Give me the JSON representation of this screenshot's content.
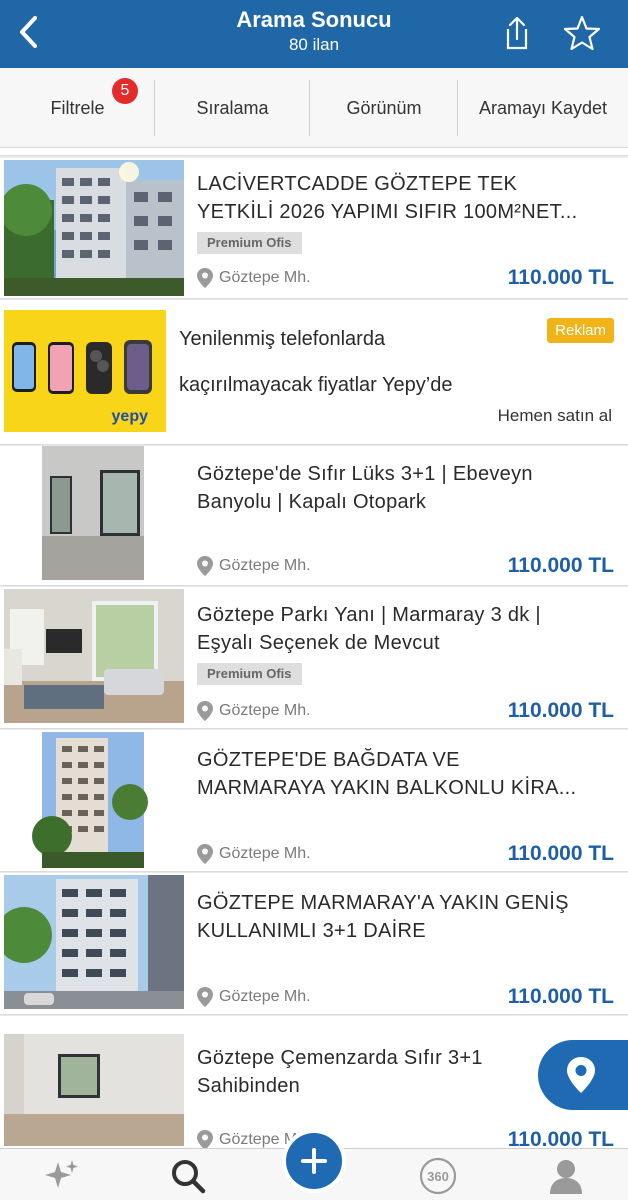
{
  "header": {
    "title": "Arama Sonucu",
    "count": "80 ilan"
  },
  "toolbar": {
    "filter_label": "Filtrele",
    "filter_count": "5",
    "sort_label": "Sıralama",
    "view_label": "Görünüm",
    "save_label": "Aramayı Kaydet"
  },
  "listings": [
    {
      "title1": "LACİVERTCADDE GÖZTEPE TEK",
      "title2": "YETKİLİ 2026 YAPIMI SIFIR 100M²NET...",
      "badge": "Premium Ofis",
      "location": "Göztepe Mh.",
      "price": "110.000 TL"
    },
    {
      "title1": "Göztepe'de Sıfır Lüks 3+1 | Ebeveyn",
      "title2": "Banyolu | Kapalı Otopark",
      "badge": "",
      "location": "Göztepe Mh.",
      "price": "110.000 TL"
    },
    {
      "title1": "Göztepe Parkı Yanı | Marmaray 3 dk |",
      "title2": "Eşyalı Seçenek de Mevcut",
      "badge": "Premium Ofis",
      "location": "Göztepe Mh.",
      "price": "110.000 TL"
    },
    {
      "title1": "GÖZTEPE'DE BAĞDATA VE",
      "title2": "MARMARAYA YAKIN BALKONLU KİRA...",
      "badge": "",
      "location": "Göztepe Mh.",
      "price": "110.000 TL"
    },
    {
      "title1": "GÖZTEPE MARMARAY'A YAKIN GENİŞ",
      "title2": "KULLANIMLI 3+1 DAİRE",
      "badge": "",
      "location": "Göztepe Mh.",
      "price": "110.000 TL"
    },
    {
      "title1": "Göztepe Çemenzarda Sıfır 3+1",
      "title2": "Sahibinden",
      "badge": "",
      "location": "Göztepe Mh.",
      "price": "110.000 TL"
    }
  ],
  "ad": {
    "line1": "Yenilenmiş telefonlarda",
    "line2": "kaçırılmayacak fiyatlar Yepy’de",
    "badge": "Reklam",
    "cta": "Hemen satın al",
    "brand": "yepy"
  },
  "colors": {
    "primary": "#2067a8",
    "price": "#1f5fa6",
    "badge_red": "#e32b2b",
    "ad_yellow": "#f9d51a",
    "ad_badge": "#f0b418"
  },
  "tabs": [
    "sparkle-icon",
    "search-icon",
    "plus-icon",
    "360-icon",
    "profile-icon"
  ],
  "tab_360_label": "360"
}
